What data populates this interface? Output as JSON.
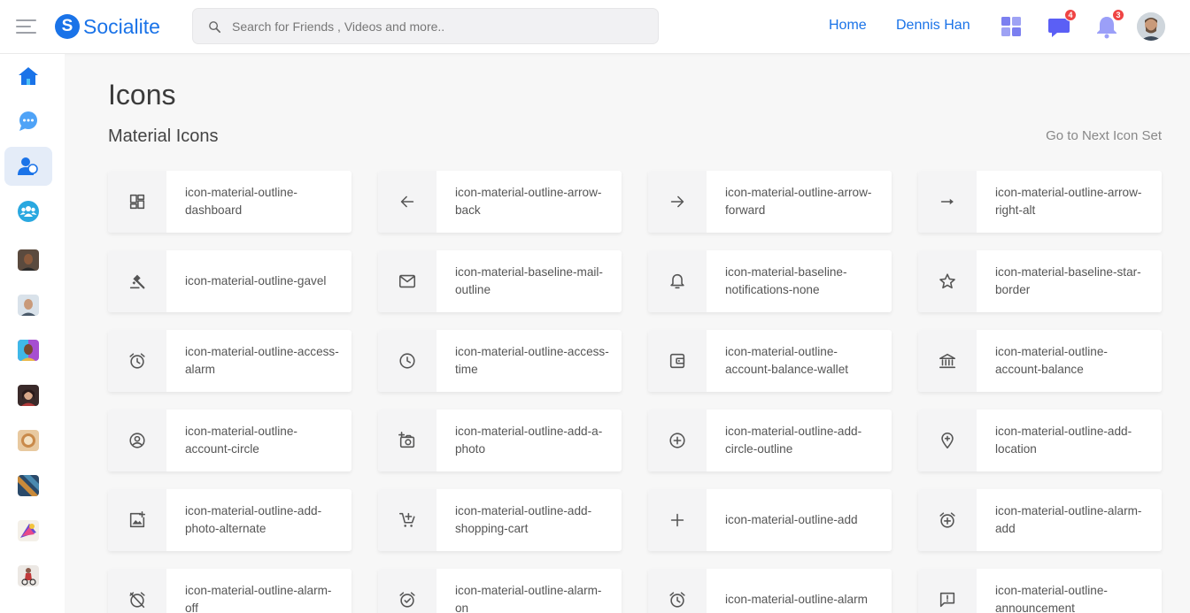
{
  "header": {
    "brand_letter": "S",
    "brand_name": "Socialite",
    "search_placeholder": "Search for Friends , Videos and more..",
    "nav_home": "Home",
    "nav_user": "Dennis Han",
    "messages_badge": "4",
    "notifications_badge": "3"
  },
  "sidebar": {
    "items": [
      "home-icon",
      "chat-icon",
      "friends-icon",
      "groups-icon"
    ],
    "contacts": [
      "contact-1",
      "contact-2",
      "contact-3",
      "contact-4",
      "contact-5",
      "contact-6",
      "contact-7",
      "contact-8"
    ]
  },
  "main": {
    "title": "Icons",
    "section_title": "Material Icons",
    "next_link": "Go to Next Icon Set",
    "icons": [
      {
        "label": "icon-material-outline-dashboard",
        "icon": "dashboard-icon"
      },
      {
        "label": "icon-material-outline-arrow-back",
        "icon": "arrow-back-icon"
      },
      {
        "label": "icon-material-outline-arrow-forward",
        "icon": "arrow-forward-icon"
      },
      {
        "label": "icon-material-outline-arrow-right-alt",
        "icon": "arrow-right-alt-icon"
      },
      {
        "label": "icon-material-outline-gavel",
        "icon": "gavel-icon"
      },
      {
        "label": "icon-material-baseline-mail-outline",
        "icon": "mail-icon"
      },
      {
        "label": "icon-material-baseline-notifications-none",
        "icon": "notification-bell-icon"
      },
      {
        "label": "icon-material-baseline-star-border",
        "icon": "star-icon"
      },
      {
        "label": "icon-material-outline-access-alarm",
        "icon": "alarm-clock-icon"
      },
      {
        "label": "icon-material-outline-access-time",
        "icon": "clock-icon"
      },
      {
        "label": "icon-material-outline-account-balance-wallet",
        "icon": "wallet-icon"
      },
      {
        "label": "icon-material-outline-account-balance",
        "icon": "bank-icon"
      },
      {
        "label": "icon-material-outline-account-circle",
        "icon": "account-circle-icon"
      },
      {
        "label": "icon-material-outline-add-a-photo",
        "icon": "add-photo-icon"
      },
      {
        "label": "icon-material-outline-add-circle-outline",
        "icon": "add-circle-icon"
      },
      {
        "label": "icon-material-outline-add-location",
        "icon": "add-location-icon"
      },
      {
        "label": "icon-material-outline-add-photo-alternate",
        "icon": "add-photo-alternate-icon"
      },
      {
        "label": "icon-material-outline-add-shopping-cart",
        "icon": "add-shopping-cart-icon"
      },
      {
        "label": "icon-material-outline-add",
        "icon": "plus-icon"
      },
      {
        "label": "icon-material-outline-alarm-add",
        "icon": "alarm-add-icon"
      },
      {
        "label": "icon-material-outline-alarm-off",
        "icon": "alarm-off-icon"
      },
      {
        "label": "icon-material-outline-alarm-on",
        "icon": "alarm-on-icon"
      },
      {
        "label": "icon-material-outline-alarm",
        "icon": "alarm-icon"
      },
      {
        "label": "icon-material-outline-announcement",
        "icon": "announcement-icon"
      }
    ]
  },
  "colors": {
    "brand": "#1a73e8",
    "badge": "#ef4444",
    "apps_icon": "#7b7ff0",
    "messages_icon": "#5b5ff5",
    "bell_icon": "#9b9ff8",
    "icon_gray": "#555555"
  }
}
